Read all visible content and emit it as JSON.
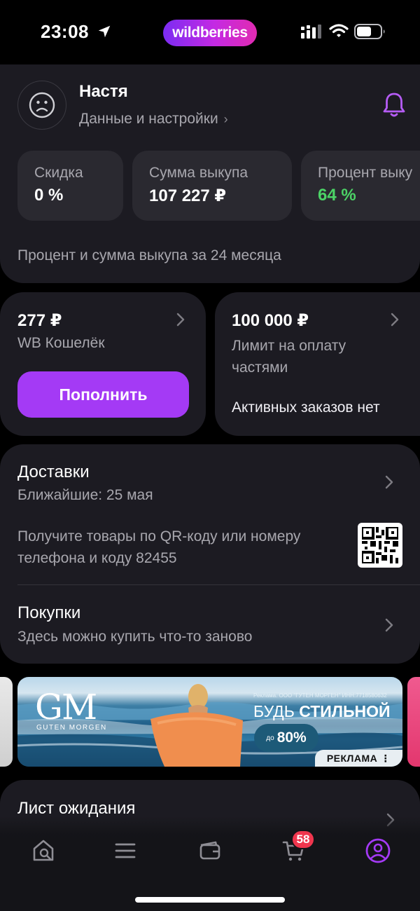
{
  "status_bar": {
    "time": "23:08",
    "brand": "wildberries",
    "icons": [
      "location-arrow-icon",
      "signal-icon",
      "wifi-icon",
      "battery-icon"
    ]
  },
  "profile": {
    "name": "Настя",
    "settings_link": "Данные и настройки",
    "chevron": "›",
    "stats": [
      {
        "label": "Скидка",
        "value": "0 %"
      },
      {
        "label": "Сумма выкупа",
        "value": "107 227 ₽"
      },
      {
        "label": "Процент выку",
        "value": "64 %"
      }
    ],
    "period_note": "Процент и сумма выкупа за 24 месяца"
  },
  "wallet": {
    "amount": "277 ₽",
    "label": "WB Кошелёк",
    "topup_label": "Пополнить"
  },
  "installments": {
    "amount": "100 000 ₽",
    "label": "Лимит на оплату частями",
    "status": "Активных заказов нет"
  },
  "deliveries": {
    "title": "Доставки",
    "subtitle": "Ближайшие: 25 мая",
    "info": "Получите товары по QR-коду или номеру телефона и коду 82455"
  },
  "purchases": {
    "title": "Покупки",
    "subtitle": "Здесь можно купить что-то заново"
  },
  "banner": {
    "logo": "GM",
    "logo_sub": "GUTEN MORGEN",
    "legal": "Реклама. ООО \"ГУТЕН МОРГЕН\" ИНН:7718580632",
    "headline_prefix": "БУДЬ",
    "headline_bold": "СТИЛЬНОЙ",
    "discount_prefix": "до",
    "discount": "80%",
    "ad_label": "РЕКЛАМА ⋮"
  },
  "waitlist": {
    "title": "Лист ожидания"
  },
  "tabbar": {
    "items": [
      "home-search-icon",
      "catalog-menu-icon",
      "wallet-icon",
      "cart-icon",
      "profile-icon"
    ],
    "cart_badge": "58",
    "active": "profile",
    "accent": "#a43af5"
  },
  "colors": {
    "accent": "#a43af5",
    "positive": "#4cd366",
    "badge": "#f0364e",
    "card": "#1c1b22"
  }
}
